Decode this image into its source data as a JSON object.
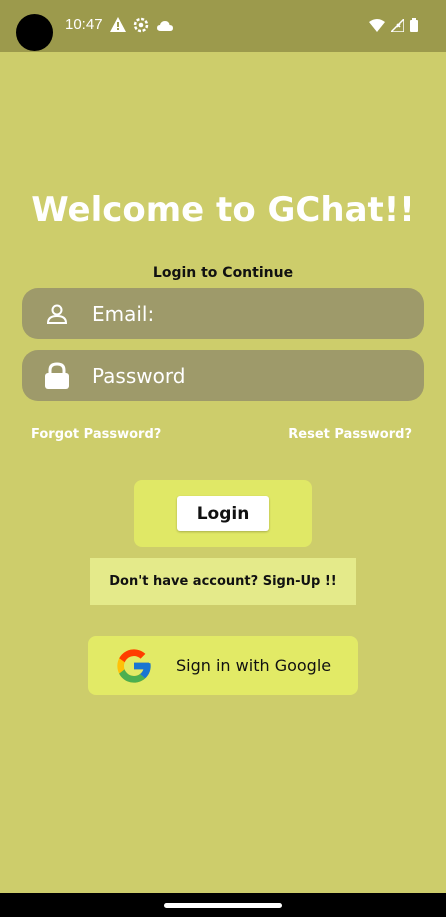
{
  "status_bar": {
    "time": "10:47"
  },
  "main": {
    "title": "Welcome to GChat!!",
    "subtitle": "Login to Continue",
    "email_placeholder": "Email:",
    "password_placeholder": "Password",
    "forgot_password": "Forgot Password?",
    "reset_password": "Reset Password?",
    "login_label": "Login",
    "signup_label": "Don't have account? Sign-Up !!",
    "google_label": "Sign in with Google"
  },
  "colors": {
    "background": "#cdcd6b",
    "status_bar": "#9c9a4c",
    "field_bg": "#9e9a6a",
    "accent": "#e0e866"
  }
}
